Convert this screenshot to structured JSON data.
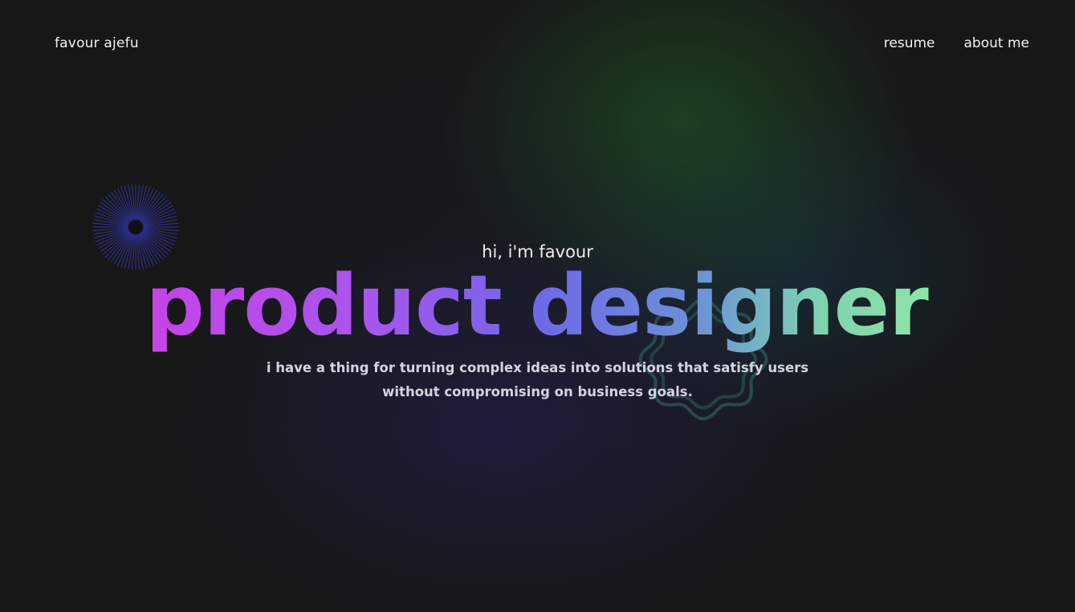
{
  "nav": {
    "brand": "favour ajefu",
    "links": [
      {
        "label": "resume"
      },
      {
        "label": "about me"
      }
    ]
  },
  "hero": {
    "greeting": "hi, i'm favour",
    "headline": "product designer",
    "tagline": "i have a thing for turning complex ideas into solutions that satisfy users without compromising on business goals."
  },
  "colors": {
    "background": "#171717",
    "headline_gradient": [
      "#c544e8",
      "#a955ec",
      "#6f68e8",
      "#6c90d8",
      "#7ed2b0",
      "#8ee5a8"
    ],
    "starburst": "#2d2f8a",
    "blob_outline": "#2f5a56"
  },
  "decorations": {
    "starburst_icon": "starburst-icon",
    "blob_icon": "wavy-blob-icon"
  }
}
